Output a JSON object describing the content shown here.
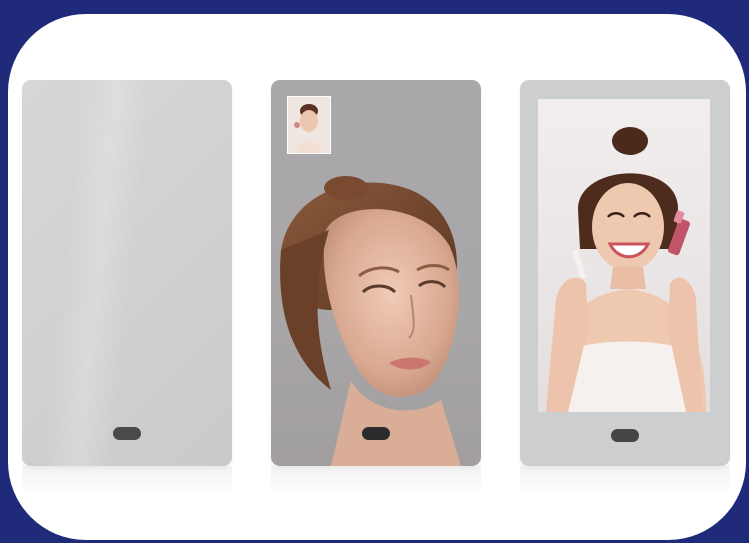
{
  "scene": {
    "background_color": "#1f2a7a",
    "card_color": "#ffffff",
    "panels": [
      {
        "kind": "blank-mirror",
        "button_icon": "home-button-icon"
      },
      {
        "kind": "mirror-with-reflection",
        "thumbnail": "face-thumbnail",
        "button_icon": "home-button-icon"
      },
      {
        "kind": "display-screen",
        "content": "smiling-woman-with-cosmetics",
        "button_icon": "home-button-icon"
      }
    ]
  }
}
